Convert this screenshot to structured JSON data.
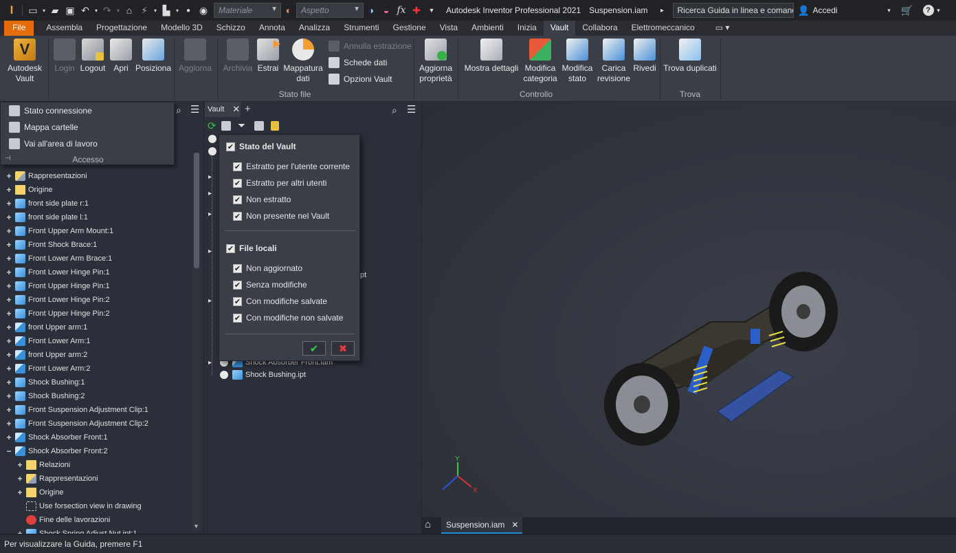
{
  "titlebar": {
    "app_title": "Autodesk Inventor Professional 2021",
    "document": "Suspension.iam",
    "material_placeholder": "Materiale",
    "appearance_placeholder": "Aspetto",
    "search": "Ricerca Guida in linea e comand",
    "sign_in": "Accedi"
  },
  "menu_tabs": [
    "File",
    "Assembla",
    "Progettazione",
    "Modello 3D",
    "Schizzo",
    "Annota",
    "Analizza",
    "Strumenti",
    "Gestione",
    "Vista",
    "Ambienti",
    "Inizia",
    "Vault",
    "Collabora",
    "Elettromeccanico"
  ],
  "active_tab": "Vault",
  "ribbon": {
    "autodesk_vault": "Autodesk\nVault",
    "login": "Login",
    "logout": "Logout",
    "apri": "Apri",
    "posiziona": "Posiziona",
    "aggiorna": "Aggiorna",
    "archivia": "Archivia",
    "estrai": "Estrai",
    "mappatura": "Mappatura\ndati",
    "annulla_estrazione": "Annulla estrazione",
    "schede_dati": "Schede dati",
    "opzioni_vault": "Opzioni Vault",
    "stato_file": "Stato file",
    "aggiorna_proprieta": "Aggiorna\nproprietà",
    "mostra_dettagli": "Mostra dettagli",
    "modifica_categoria": "Modifica\ncategoria",
    "modifica_stato": "Modifica\nstato",
    "carica_revisione": "Carica\nrevisione",
    "rivedi": "Rivedi",
    "controllo": "Controllo",
    "trova_duplicati": "Trova duplicati",
    "trova": "Trova"
  },
  "access_menu": {
    "items": [
      "Stato connessione",
      "Mappa cartelle",
      "Vai all'area di lavoro"
    ],
    "label": "Accesso"
  },
  "left_tree": [
    {
      "label": "Rappresentazioni",
      "icon": "rep",
      "indent": 0
    },
    {
      "label": "Origine",
      "icon": "folder",
      "indent": 0
    },
    {
      "label": "front side plate r:1",
      "icon": "part",
      "indent": 0
    },
    {
      "label": "front side plate l:1",
      "icon": "part",
      "indent": 0
    },
    {
      "label": "Front Upper Arm Mount:1",
      "icon": "part",
      "indent": 0
    },
    {
      "label": "Front Shock Brace:1",
      "icon": "part",
      "indent": 0
    },
    {
      "label": "Front Lower Arm Brace:1",
      "icon": "part",
      "indent": 0
    },
    {
      "label": "Front Lower Hinge Pin:1",
      "icon": "part",
      "indent": 0
    },
    {
      "label": "Front Upper Hinge Pin:1",
      "icon": "part",
      "indent": 0
    },
    {
      "label": "Front Lower Hinge Pin:2",
      "icon": "part",
      "indent": 0
    },
    {
      "label": "Front Upper Hinge Pin:2",
      "icon": "part",
      "indent": 0
    },
    {
      "label": "front Upper arm:1",
      "icon": "asm",
      "indent": 0
    },
    {
      "label": "Front Lower Arm:1",
      "icon": "asm",
      "indent": 0
    },
    {
      "label": "front Upper arm:2",
      "icon": "asm",
      "indent": 0
    },
    {
      "label": "Front Lower Arm:2",
      "icon": "asm",
      "indent": 0
    },
    {
      "label": "Shock Bushing:1",
      "icon": "part",
      "indent": 0
    },
    {
      "label": "Shock Bushing:2",
      "icon": "part",
      "indent": 0
    },
    {
      "label": "Front Suspension Adjustment Clip:1",
      "icon": "part",
      "indent": 0
    },
    {
      "label": "Front Suspension Adjustment Clip:2",
      "icon": "part",
      "indent": 0
    },
    {
      "label": "Shock Absorber Front:1",
      "icon": "asm",
      "indent": 0
    },
    {
      "label": "Shock Absorber Front:2",
      "icon": "asm",
      "indent": 0,
      "expanded": true
    },
    {
      "label": "Relazioni",
      "icon": "folder",
      "indent": 1
    },
    {
      "label": "Rappresentazioni",
      "icon": "rep",
      "indent": 1
    },
    {
      "label": "Origine",
      "icon": "folder",
      "indent": 1
    },
    {
      "label": "Use forsection view in drawing",
      "icon": "box",
      "indent": 1
    },
    {
      "label": "Fine delle lavorazioni",
      "icon": "err",
      "indent": 1
    },
    {
      "label": "Shock Spring Adjust Nut.ipt:1",
      "icon": "part",
      "indent": 1
    }
  ],
  "vault_panel": {
    "tab": "Vault",
    "files": [
      "Shock Absorber Front.iam",
      "Shock Bushing.ipt"
    ],
    "partial_text": "pt"
  },
  "filter_popup": {
    "vault_state": "Stato del Vault",
    "vault_items": [
      "Estratto per l'utente corrente",
      "Estratto per altri utenti",
      "Non estratto",
      "Non presente nel Vault"
    ],
    "local_files": "File locali",
    "local_items": [
      "Non aggiornato",
      "Senza modifiche",
      "Con modifiche salvate",
      "Con modifiche non salvate"
    ]
  },
  "document_tab": "Suspension.iam",
  "statusbar": "Per visualizzare la Guida, premere F1",
  "axis": {
    "x": "X",
    "y": "Y"
  },
  "colors": {
    "accent": "#e46c0a",
    "ribbon": "#3a3e47",
    "background": "#2b2f39",
    "tab_underline": "#1f8fd6"
  }
}
